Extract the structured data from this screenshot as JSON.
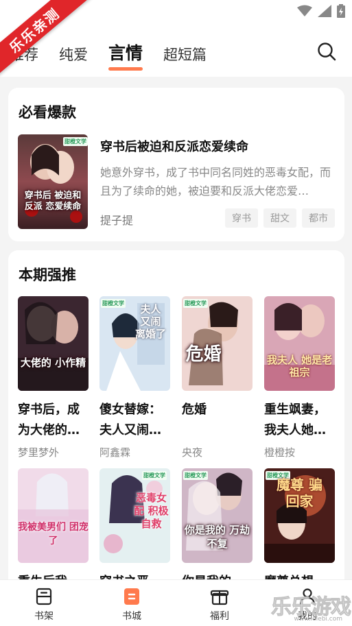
{
  "ribbon": {
    "text": "乐乐亲测"
  },
  "tabs": [
    {
      "label": "推荐",
      "active": false
    },
    {
      "label": "纯爱",
      "active": false
    },
    {
      "label": "言情",
      "active": true
    },
    {
      "label": "超短篇",
      "active": false
    }
  ],
  "featured": {
    "section_title": "必看爆款",
    "book": {
      "title": "穿书后被迫和反派恋爱续命",
      "description": "她意外穿书，成了书中同名同姓的恶毒女配，而且为了续命的她，被迫要和反派大佬恋爱…",
      "author": "提子提",
      "tags": [
        "穿书",
        "甜文",
        "都市"
      ],
      "cover_text": "穿书后 被迫和反派 恋爱续命"
    }
  },
  "weekly": {
    "section_title": "本期强推",
    "books": [
      {
        "title": "穿书后，成为大佬的…",
        "author": "梦里梦外",
        "cover_text": "大佬的 小作精"
      },
      {
        "title": "傻女替嫁：夫人又闹…",
        "author": "阿鑫霖",
        "cover_text": "夫人 又闹 离婚了"
      },
      {
        "title": "危婚",
        "author": "央夜",
        "cover_text": "危婚"
      },
      {
        "title": "重生飒妻，我夫人她…",
        "author": "橙橙按",
        "cover_text": "我夫人 她是老祖宗"
      },
      {
        "title": "重生后我被…",
        "author": "",
        "cover_text": "我被美男们 团宠了"
      },
      {
        "title": "穿书之恶毒…",
        "author": "",
        "cover_text": "恶毒女配 积极自救"
      },
      {
        "title": "你是我的万…",
        "author": "",
        "cover_text": "你是我的 万劫不复"
      },
      {
        "title": "魔尊总想把…",
        "author": "",
        "cover_text": "魔尊 骗回家"
      }
    ]
  },
  "badge_text": "甜橙文学",
  "bottom_nav": [
    {
      "label": "书架",
      "icon": "bookshelf-icon"
    },
    {
      "label": "书城",
      "icon": "bookstore-icon",
      "active": true
    },
    {
      "label": "福利",
      "icon": "gift-icon"
    },
    {
      "label": "我的",
      "icon": "profile-icon"
    }
  ],
  "watermark": {
    "text": "乐乐游戏",
    "url": "www.lelebi.com"
  },
  "colors": {
    "accent": "#ff7a4d",
    "ribbon": "#e0262a"
  }
}
